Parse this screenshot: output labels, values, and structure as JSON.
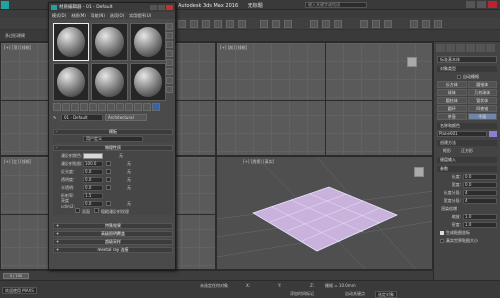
{
  "app": {
    "title": "Autodesk 3ds Max 2016",
    "file": "无标题",
    "search_placeholder": "键入关键字或短语"
  },
  "ribbon_text": "多边形建模",
  "viewports": {
    "top_label": "[+] [顶] [线框]",
    "front_label": "[+] [前] [线框]",
    "left_label": "[+] [左] [线框]",
    "persp_label": "[+] [透视] [真实]"
  },
  "material_editor": {
    "title": "材质编辑器 - 01 - Default",
    "menu": [
      "模式(D)",
      "材质(M)",
      "导航(N)",
      "选项(O)",
      "实用程序(U)"
    ],
    "material_name": "01 - Default",
    "material_type": "Architectural",
    "rollouts": {
      "templates": "模板",
      "template_value": "用户定义",
      "physical": "物理性质",
      "special": "特殊效果",
      "adv_lighting": "高级照明覆盖",
      "supersample": "超级采样",
      "mental_ray": "mental ray 连接"
    },
    "params": [
      {
        "label": "漫反射颜色:",
        "value": "",
        "map": "无"
      },
      {
        "label": "漫反射贴图:",
        "value": "100.0",
        "map": "无"
      },
      {
        "label": "反光度:",
        "value": "0.0",
        "map": "无"
      },
      {
        "label": "透明度:",
        "value": "0.0",
        "map": "无"
      },
      {
        "label": "半透明:",
        "value": "0.0",
        "map": "无"
      },
      {
        "label": "折射率:",
        "value": "1.5",
        "map": ""
      },
      {
        "label": "亮度 cd/m2:",
        "value": "0.0",
        "map": "无"
      }
    ],
    "two_sided": "双面",
    "raw_diffuse": "粗糙漫反射纹理"
  },
  "command_panel": {
    "dropdown": "标准基本体",
    "object_type": "对象类型",
    "autogrid": "自动栅格",
    "primitives": [
      "长方体",
      "圆锥体",
      "球体",
      "几何球体",
      "圆柱体",
      "管状体",
      "圆环",
      "四棱锥",
      "茶壶",
      "平面"
    ],
    "name_color": "名称和颜色",
    "object_name": "Plane001",
    "creation_method": "创建方法",
    "methods": [
      "矩形",
      "正方形"
    ],
    "keyboard_entry": "键盘输入",
    "parameters": "参数",
    "rows": [
      {
        "label": "长度:",
        "value": "0.0"
      },
      {
        "label": "宽度:",
        "value": "0.0"
      },
      {
        "label": "长度分段:",
        "value": "4"
      },
      {
        "label": "宽度分段:",
        "value": "4"
      }
    ],
    "render_multipliers": "渲染倍增",
    "scale_label": "缩放:",
    "scale_value": "1.0",
    "density_label": "密度:",
    "density_value": "1.0",
    "gen_mapping": "生成贴图坐标",
    "real_world": "真实世界贴图大小"
  },
  "status": {
    "timeline": "0 / 100",
    "welcome": "欢迎使用 MAXS",
    "selected": "未选定任何对象",
    "x": "X:",
    "y": "Y:",
    "z": "Z:",
    "grid": "栅格 = 10.0mm",
    "autokey": "自动关键点",
    "selected_obj": "选定对象",
    "add_time_tag": "添加时间标记"
  }
}
